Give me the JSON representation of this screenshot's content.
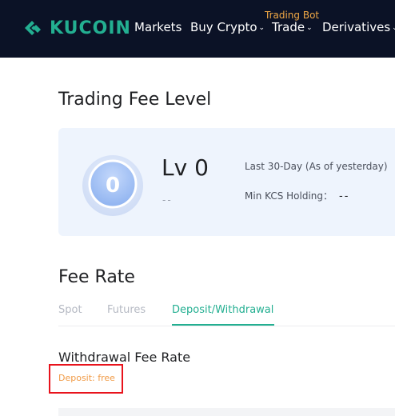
{
  "header": {
    "logo_text": "KUCOIN",
    "logo_color": "#23af91",
    "nav": {
      "markets": "Markets",
      "buy_crypto": "Buy Crypto",
      "trade": "Trade",
      "derivatives": "Derivatives",
      "trading_bot_badge": "Trading Bot"
    },
    "background_color": "#0b1226"
  },
  "fee_level": {
    "title": "Trading Fee Level",
    "badge_value": "0",
    "level_label": "Lv 0",
    "level_sub": "--",
    "last_30_day_label": "Last 30-Day (As of yesterday)",
    "min_kcs_label": "Min KCS Holding：",
    "min_kcs_value": "--"
  },
  "fee_rate": {
    "title": "Fee Rate",
    "tabs": [
      "Spot",
      "Futures",
      "Deposit/Withdrawal"
    ],
    "active_tab": "Deposit/Withdrawal",
    "accent_color": "#23af91"
  },
  "withdrawal": {
    "title": "Withdrawal Fee Rate",
    "deposit_note": "Deposit: free",
    "note_color": "#f09a45"
  }
}
